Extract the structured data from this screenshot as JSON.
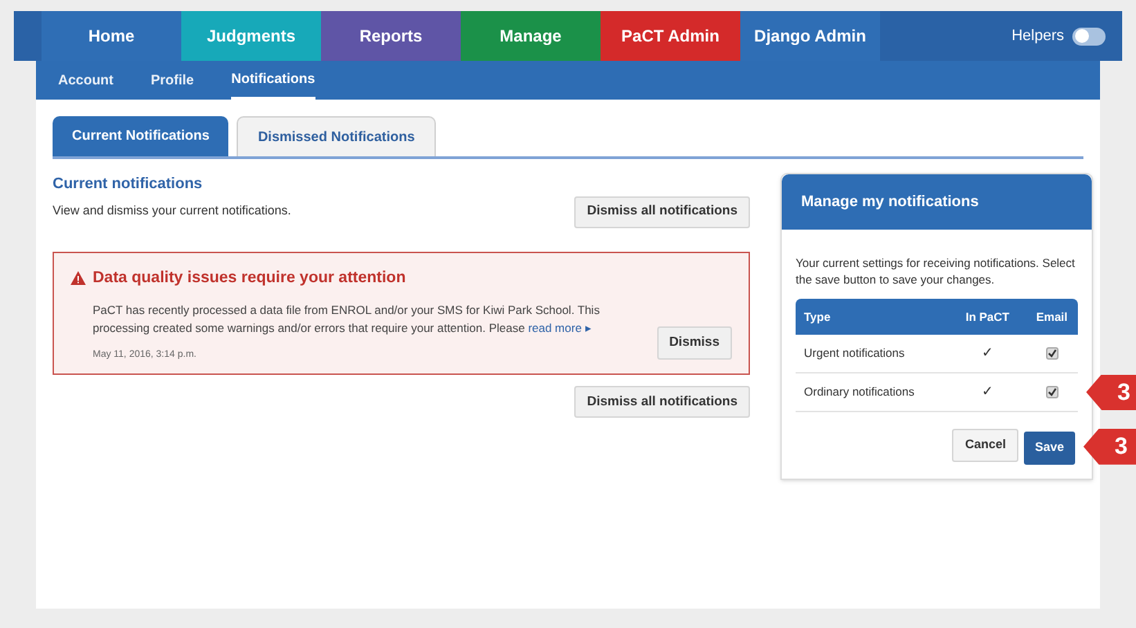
{
  "nav": {
    "items": [
      {
        "label": "Home",
        "color": "#2f6eb5"
      },
      {
        "label": "Judgments",
        "color": "#17a9b9"
      },
      {
        "label": "Reports",
        "color": "#5f55a6"
      },
      {
        "label": "Manage",
        "color": "#1b9149"
      },
      {
        "label": "PaCT Admin",
        "color": "#d42a2a"
      },
      {
        "label": "Django Admin",
        "color": "#2f6eb5"
      }
    ],
    "helpers": {
      "label": "Helpers",
      "on": false
    }
  },
  "subnav": [
    {
      "label": "Account",
      "selected": false
    },
    {
      "label": "Profile",
      "selected": false
    },
    {
      "label": "Notifications",
      "selected": true
    }
  ],
  "tabs": [
    {
      "label": "Current Notifications",
      "selected": true
    },
    {
      "label": "Dismissed Notifications",
      "selected": false
    }
  ],
  "main": {
    "heading": "Current notifications",
    "description": "View and dismiss your current notifications.",
    "dismiss_all": "Dismiss all notifications",
    "alert": {
      "title": "Data quality issues require your attention",
      "body": "PaCT has recently processed a data file from ENROL and/or your SMS for Kiwi Park School. This processing created some warnings and/or errors that require your attention. Please",
      "link": "read more ▸",
      "date": "May 11, 2016, 3:14 p.m.",
      "dismiss": "Dismiss"
    },
    "dismiss_all_bottom": "Dismiss all notifications"
  },
  "panel": {
    "title": "Manage my notifications",
    "description": "Your current settings for receiving notifications. Select the save button to save your changes.",
    "columns": [
      "Type",
      "In PaCT",
      "Email"
    ],
    "rows": [
      {
        "type": "Urgent notifications",
        "in_pact": "✓",
        "email": true,
        "callout": ""
      },
      {
        "type": "Ordinary notifications",
        "in_pact": "✓",
        "email": true,
        "callout": "3"
      }
    ],
    "cancel": "Cancel",
    "save": "Save",
    "save_callout": "3"
  }
}
